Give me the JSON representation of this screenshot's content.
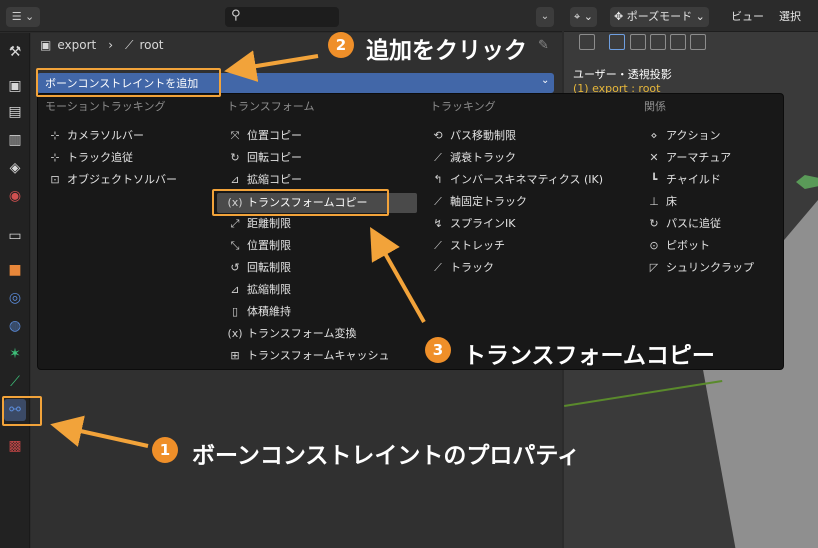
{
  "left_header": {
    "editor_type_icon": "properties-icon",
    "search_value": "",
    "collapse_glyph": "⌄"
  },
  "breadcrumb": {
    "armature": "export",
    "bone": "root"
  },
  "add_constraint": {
    "label": "ボーンコンストレイントを追加"
  },
  "viewport": {
    "mode": "ポーズモード",
    "view_menu": "ビュー",
    "select_menu": "選択",
    "view_name": "ユーザー・透視投影",
    "object_name": "(1) export : root"
  },
  "menu": {
    "columns": [
      {
        "header": "モーショントラッキング",
        "items": [
          {
            "label": "カメラソルバー",
            "icon": "camera-solver-icon"
          },
          {
            "label": "トラック追従",
            "icon": "follow-track-icon"
          },
          {
            "label": "オブジェクトソルバー",
            "icon": "object-solver-icon"
          }
        ]
      },
      {
        "header": "トランスフォーム",
        "items": [
          {
            "label": "位置コピー",
            "icon": "copy-location-icon"
          },
          {
            "label": "回転コピー",
            "icon": "copy-rotation-icon"
          },
          {
            "label": "拡縮コピー",
            "icon": "copy-scale-icon"
          },
          {
            "label": "トランスフォームコピー",
            "icon": "copy-transforms-icon"
          },
          {
            "label": "距離制限",
            "icon": "limit-distance-icon"
          },
          {
            "label": "位置制限",
            "icon": "limit-location-icon"
          },
          {
            "label": "回転制限",
            "icon": "limit-rotation-icon"
          },
          {
            "label": "拡縮制限",
            "icon": "limit-scale-icon"
          },
          {
            "label": "体積維持",
            "icon": "maintain-volume-icon"
          },
          {
            "label": "トランスフォーム変換",
            "icon": "transformation-icon"
          },
          {
            "label": "トランスフォームキャッシュ",
            "icon": "transform-cache-icon"
          }
        ]
      },
      {
        "header": "トラッキング",
        "items": [
          {
            "label": "パス移動制限",
            "icon": "clamp-to-icon"
          },
          {
            "label": "減衰トラック",
            "icon": "damped-track-icon"
          },
          {
            "label": "インバースキネマティクス (IK)",
            "icon": "ik-icon"
          },
          {
            "label": "軸固定トラック",
            "icon": "locked-track-icon"
          },
          {
            "label": "スプラインIK",
            "icon": "spline-ik-icon"
          },
          {
            "label": "ストレッチ",
            "icon": "stretch-to-icon"
          },
          {
            "label": "トラック",
            "icon": "track-to-icon"
          }
        ]
      },
      {
        "header": "関係",
        "items": [
          {
            "label": "アクション",
            "icon": "action-icon"
          },
          {
            "label": "アーマチュア",
            "icon": "armature-icon"
          },
          {
            "label": "チャイルド",
            "icon": "child-of-icon"
          },
          {
            "label": "床",
            "icon": "floor-icon"
          },
          {
            "label": "パスに追従",
            "icon": "follow-path-icon"
          },
          {
            "label": "ピボット",
            "icon": "pivot-icon"
          },
          {
            "label": "シュリンクラップ",
            "icon": "shrinkwrap-icon"
          }
        ]
      }
    ]
  },
  "annotations": {
    "step1": {
      "number": "1",
      "text": "ボーンコンストレイントのプロパティ"
    },
    "step2": {
      "number": "2",
      "text": "追加をクリック"
    },
    "step3": {
      "number": "3",
      "text": "トランスフォームコピー"
    },
    "color": "#f2a33a"
  },
  "colors": {
    "accent_blue": "#4267a8",
    "annotation_orange": "#ef8f29",
    "object_name_yellow": "#e8b83a"
  }
}
